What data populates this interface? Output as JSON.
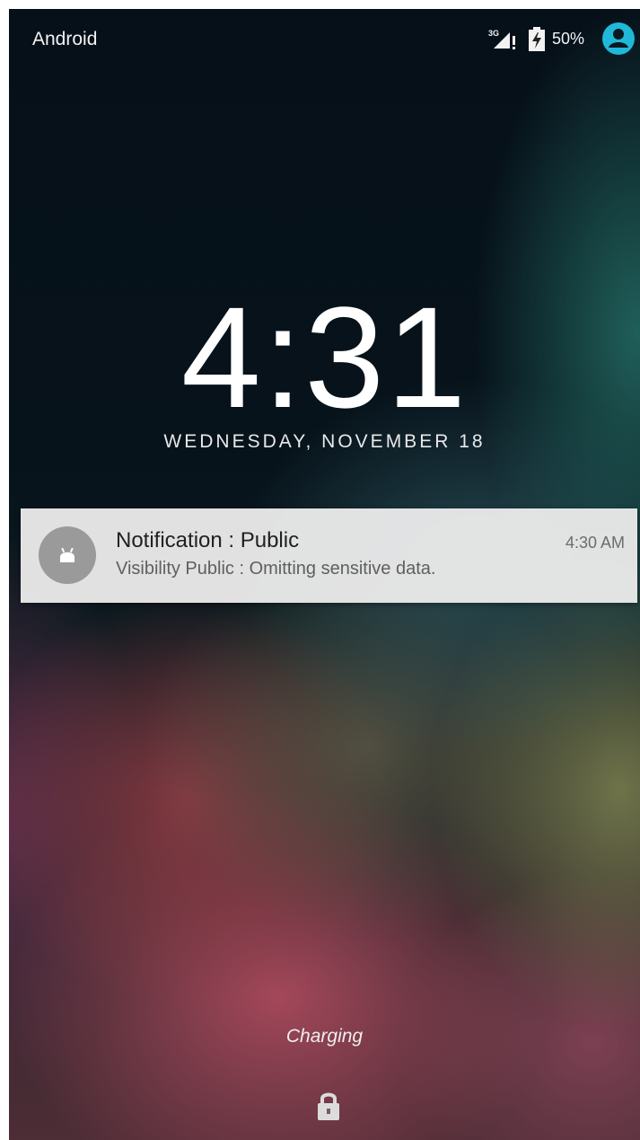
{
  "status_bar": {
    "carrier": "Android",
    "network_icon": "signal-3g-icon",
    "network_label": "3G",
    "battery_icon": "battery-charging-icon",
    "battery_percent": "50%",
    "user_icon": "user-avatar-icon",
    "accent_color": "#1fb8d8"
  },
  "lockscreen": {
    "time": "4:31",
    "date": "WEDNESDAY, NOVEMBER 18"
  },
  "notification": {
    "title": "Notification : Public",
    "text": "Visibility Public : Omitting sensitive data.",
    "time": "4:30 AM",
    "app_icon": "android-app-icon"
  },
  "footer": {
    "status": "Charging",
    "lock_icon": "lock-icon"
  }
}
